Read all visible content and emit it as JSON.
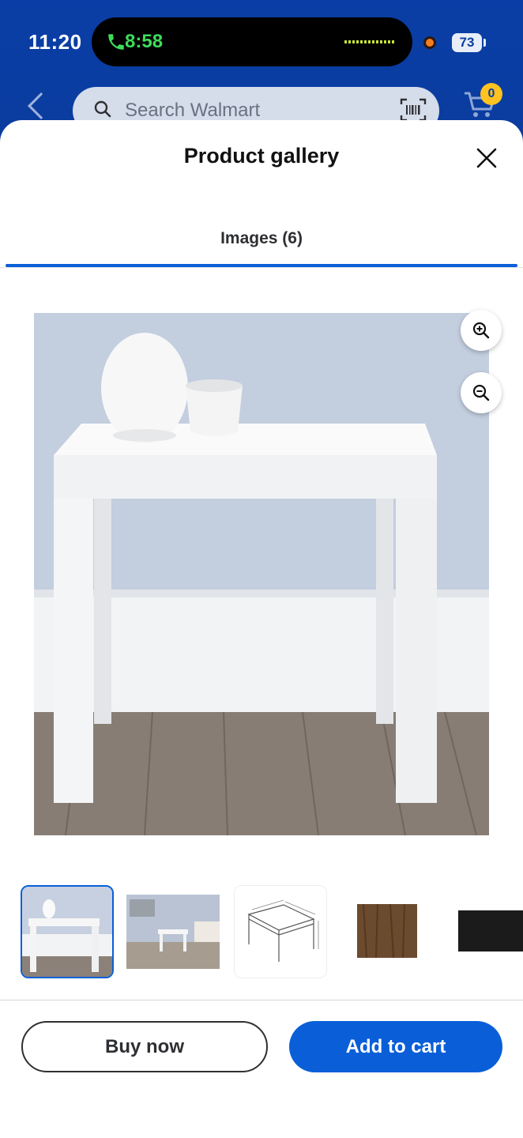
{
  "status_bar": {
    "time": "11:20",
    "call_time": "8:58",
    "battery": "73"
  },
  "header": {
    "search_placeholder": "Search Walmart",
    "cart_count": "0",
    "icons": [
      "back-chevron-icon",
      "search-icon",
      "barcode-scan-icon",
      "cart-icon"
    ]
  },
  "gallery": {
    "title": "Product gallery",
    "tab_label": "Images (6)",
    "selected_index": 0,
    "thumbnails": [
      "white-end-table",
      "table-in-bedroom",
      "dimension-drawing",
      "walnut-color-swatch",
      "black-color-swatch"
    ]
  },
  "actions": {
    "buy_now": "Buy now",
    "add_to_cart": "Add to cart"
  },
  "colors": {
    "brand_blue": "#0a3b9c",
    "accent_blue": "#0a5fd8",
    "badge_yellow": "#ffc220"
  }
}
